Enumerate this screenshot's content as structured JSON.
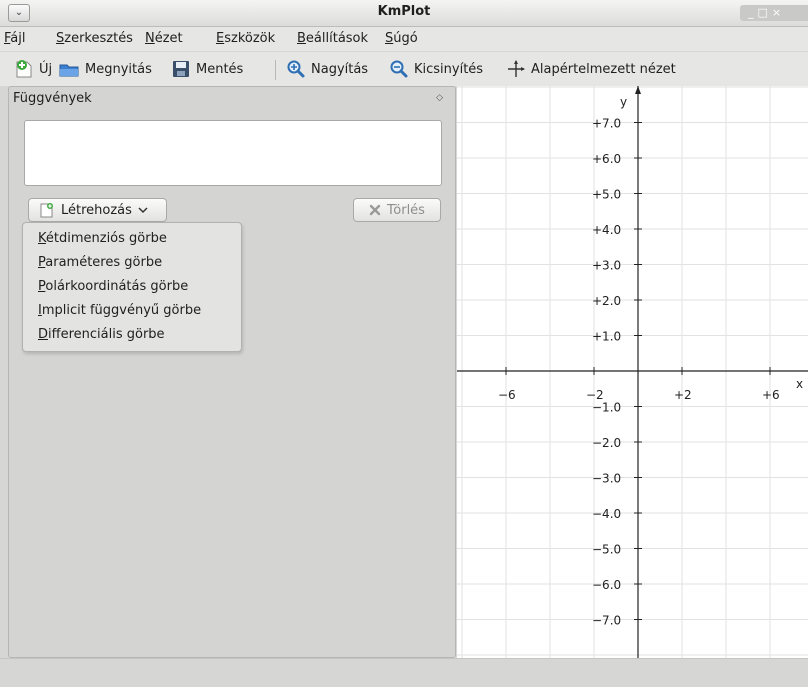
{
  "window": {
    "title": "KmPlot"
  },
  "menubar": [
    "Fájl",
    "Szerkesztés",
    "Nézet",
    "Eszközök",
    "Beállítások",
    "Súgó"
  ],
  "toolbar": {
    "new": "Új",
    "open": "Megnyitás",
    "save": "Mentés",
    "zoom_in": "Nagyítás",
    "zoom_out": "Kicsinyítés",
    "reset": "Alapértelmezett nézet"
  },
  "panel": {
    "title": "Függvények",
    "create_label": "Létrehozás",
    "delete_label": "Törlés"
  },
  "create_menu": [
    "Kétdimenziós görbe",
    "Paraméteres görbe",
    "Polárkoordinátás görbe",
    "Implicit függvényű görbe",
    "Differenciális görbe"
  ],
  "plot": {
    "x_axis_label": "x",
    "y_axis_label": "y",
    "x_ticks": [
      "−6",
      "−2",
      "+2",
      "+6"
    ],
    "y_ticks": [
      "+7.0",
      "+6.0",
      "+5.0",
      "+4.0",
      "+3.0",
      "+2.0",
      "+1.0",
      "−1.0",
      "−2.0",
      "−3.0",
      "−4.0",
      "−5.0",
      "−6.0",
      "−7.0"
    ]
  }
}
